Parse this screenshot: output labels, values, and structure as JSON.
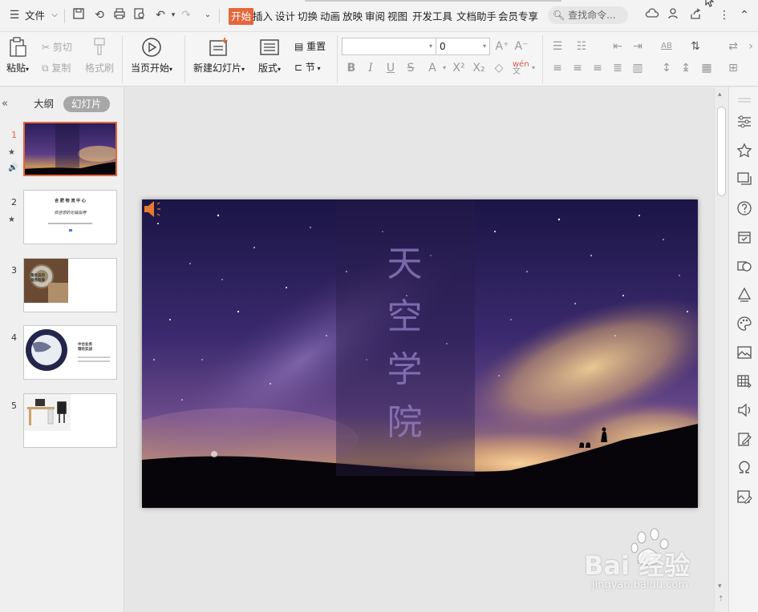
{
  "menubar": {
    "file_label": "文件",
    "tabs": [
      "开始",
      "插入",
      "设计",
      "切换",
      "动画",
      "放映",
      "审阅",
      "视图",
      "开发工具",
      "文档助手",
      "会员专享"
    ],
    "active_tab": 0,
    "search_placeholder": "查找命令..."
  },
  "ribbon": {
    "paste": "粘贴",
    "cut": "剪切",
    "copy": "复制",
    "format_painter": "格式刷",
    "from_current": "当页开始",
    "new_slide": "新建幻灯片",
    "layout": "版式",
    "reset": "重置",
    "section": "节",
    "font_name": "",
    "font_size": "0",
    "wen": "wén"
  },
  "leftpanel": {
    "tab_outline": "大纲",
    "tab_slides": "幻灯片",
    "thumbnails": [
      {
        "num": "1",
        "selected": true,
        "marks": [
          "★",
          "🔊"
        ]
      },
      {
        "num": "2",
        "selected": false,
        "marks": [
          "★"
        ]
      },
      {
        "num": "3",
        "selected": false,
        "marks": []
      },
      {
        "num": "4",
        "selected": false,
        "marks": []
      },
      {
        "num": "5",
        "selected": false,
        "marks": []
      }
    ],
    "thumb2_line1": "合 肥 物 流 中 心",
    "thumb2_line2": "欢迎您的光临指导",
    "thumb3_text": "乘务员的\n服务效果",
    "thumb4_text": "中台业务\n理论实战"
  },
  "slide": {
    "title_chars": [
      "天",
      "空",
      "学",
      "院"
    ]
  },
  "watermark": {
    "main": "Bai 经验",
    "sub": "jingyan.baidu.com"
  },
  "colors": {
    "accent": "#e5663a",
    "speaker": "#e87a2d"
  }
}
